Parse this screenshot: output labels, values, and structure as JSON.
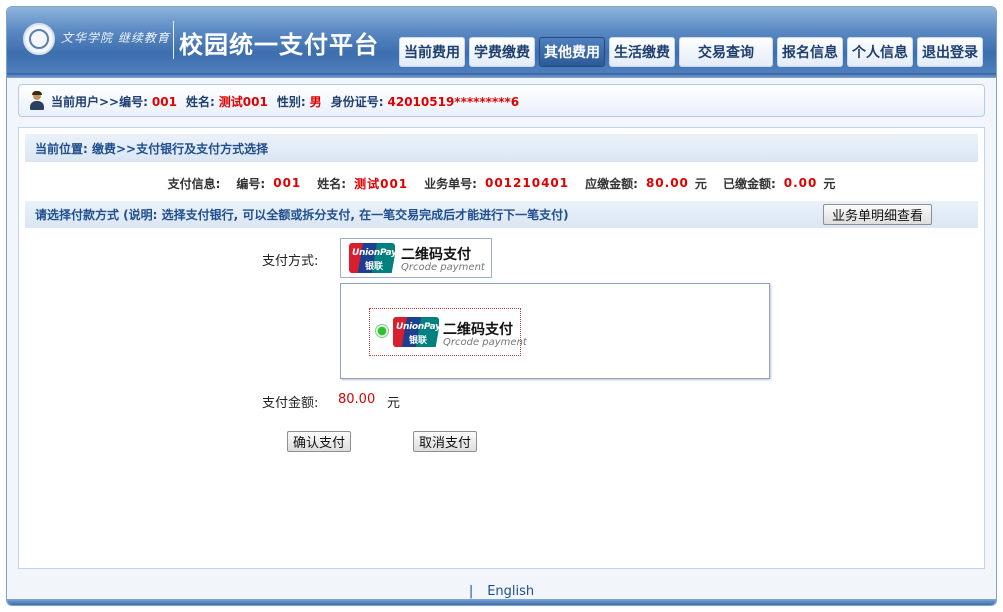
{
  "header": {
    "logo_text": "文华学院 继续教育学院",
    "platform_title": "校园统一支付平台",
    "nav": [
      {
        "label": "当前费用",
        "active": false
      },
      {
        "label": "学费缴费",
        "active": false
      },
      {
        "label": "其他费用",
        "active": true
      },
      {
        "label": "生活缴费",
        "active": false
      },
      {
        "label": "交易查询",
        "active": false
      },
      {
        "label": "报名信息",
        "active": false
      },
      {
        "label": "个人信息",
        "active": false
      },
      {
        "label": "退出登录",
        "active": false
      }
    ]
  },
  "user": {
    "prefix": "当前用户>>编号:",
    "id": "001",
    "name_label": "姓名:",
    "name": "测试001",
    "gender_label": "性别:",
    "gender": "男",
    "idcard_label": "身份证号:",
    "idcard": "42010519*********6"
  },
  "location": "当前位置: 缴费>>支付银行及支付方式选择",
  "payment_info": {
    "heading": "支付信息:",
    "id_label": "编号:",
    "id": "001",
    "name_label": "姓名:",
    "name": "测试001",
    "order_label": "业务单号:",
    "order_no": "001210401",
    "due_label": "应缴金额:",
    "due_amount": "80.00",
    "unit": "元",
    "paid_label": "已缴金额:",
    "paid_amount": "0.00"
  },
  "method": {
    "instruction": "请选择付款方式 (说明: 选择支付银行, 可以全额或拆分支付, 在一笔交易完成后才能进行下一笔支付)",
    "detail_button": "业务单明细查看",
    "method_label": "支付方式:",
    "option": {
      "logo_text": "UnionPay",
      "logo_cn": "银联",
      "title": "二维码支付",
      "subtitle": "Qrcode payment"
    },
    "amount_label": "支付金额:",
    "amount": "80.00",
    "amount_unit": "元",
    "confirm": "确认支付",
    "cancel": "取消支付"
  },
  "footer": {
    "separator": "|",
    "language": "English"
  },
  "colors": {
    "header_blue": "#3d6ead",
    "highlight_red": "#e00000",
    "label_blue": "#1f4f8e",
    "radio_green": "#2fbf2f"
  }
}
